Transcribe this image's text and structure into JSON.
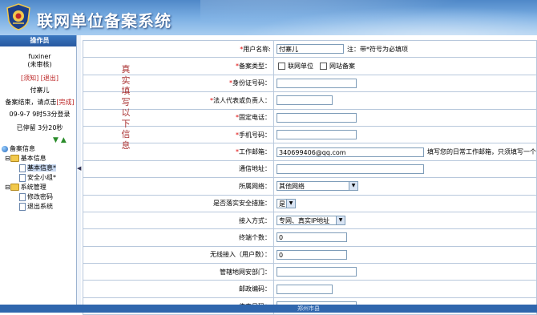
{
  "app": {
    "title": "联网单位备案系统"
  },
  "sidebar": {
    "header": "操作员",
    "username": "fuxiner",
    "status": "(未审核)",
    "link_notice": "[须知]",
    "link_logout": "[退出]",
    "unit_name": "付寨儿",
    "finish_prefix": "备案结束，请点击",
    "finish_link": "[完成]",
    "login_time": "09-9-7 9时53分登录",
    "stay_time": "已停留 3分20秒",
    "tree": {
      "root": "备案信息",
      "group1": "基本信息",
      "item1": "基本信息*",
      "item2": "安全小组*",
      "group2": "系统管理",
      "item3": "修改密码",
      "item4": "退出系统"
    }
  },
  "side_note": [
    "真",
    "实",
    "填",
    "写",
    "以",
    "下",
    "信",
    "息"
  ],
  "form": {
    "username": {
      "label": "用户名称:",
      "value": "付寨儿",
      "note": "注：带*符号为必填项"
    },
    "type": {
      "label": "备案类型：",
      "opt1": "联网单位",
      "opt2": "网站备案"
    },
    "idcard": {
      "label": "身份证号码：",
      "value": ""
    },
    "legal": {
      "label": "法人代表或负责人：",
      "value": ""
    },
    "phone": {
      "label": "固定电话：",
      "value": ""
    },
    "mobile": {
      "label": "手机号码：",
      "value": ""
    },
    "email": {
      "label": "工作邮箱：",
      "value": "340699406@qq.com",
      "note": "填写您的日常工作邮箱，只须填写一个"
    },
    "address": {
      "label": "通信地址：",
      "value": ""
    },
    "network": {
      "label": "所属网络：",
      "value": "其他网络"
    },
    "measures": {
      "label": "是否落实安全措施：",
      "value": "是"
    },
    "access": {
      "label": "接入方式：",
      "value": "专网、真实IP地址"
    },
    "terminals": {
      "label": "终端个数：",
      "value": "0"
    },
    "wireless": {
      "label": "无线接入（用户数）：",
      "value": "0"
    },
    "police": {
      "label": "管辖地网安部门：",
      "value": ""
    },
    "postcode": {
      "label": "邮政编码：",
      "value": ""
    },
    "fax": {
      "label": "传真号码：",
      "value": ""
    }
  },
  "footer": {
    "text": "郑州市县"
  }
}
